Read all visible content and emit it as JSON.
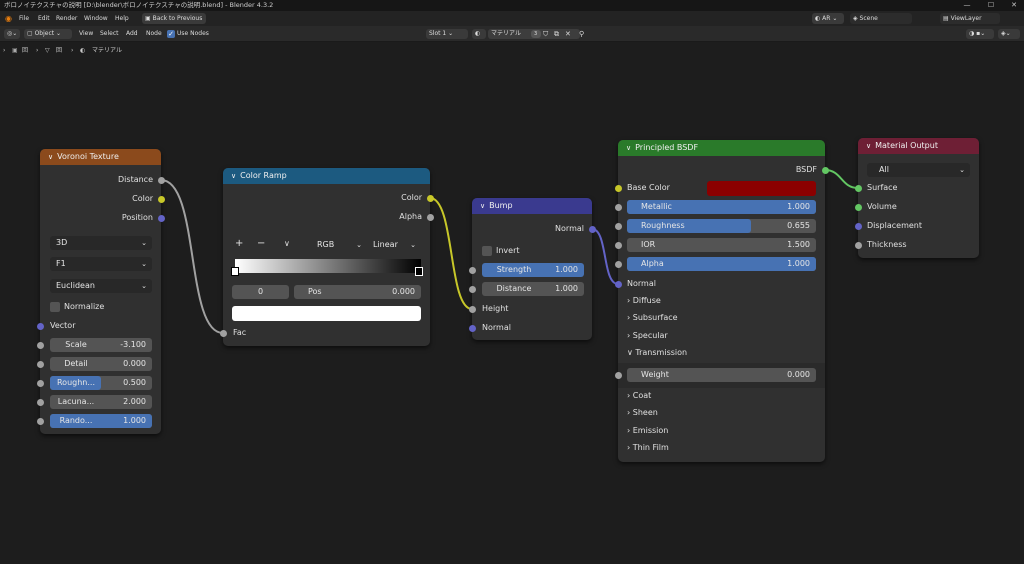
{
  "titlebar": {
    "title": "ボロノイテクスチャの説明 [D:\\blender\\ボロノイテクスチャの説明.blend] - Blender 4.3.2",
    "minimize": "—",
    "maximize": "☐",
    "close": "✕"
  },
  "menubar": {
    "items": [
      "File",
      "Edit",
      "Render",
      "Window",
      "Help"
    ],
    "back_button": "Back to Previous",
    "ar_label": "AR",
    "scene_label": "Scene",
    "viewlayer_label": "ViewLayer"
  },
  "header": {
    "mode": "Object",
    "menus": [
      "View",
      "Select",
      "Add",
      "Node"
    ],
    "use_nodes_label": "Use Nodes",
    "slot": "Slot 1",
    "material_name": "マテリアル",
    "user_count": "3"
  },
  "breadcrumb": {
    "item1": "回",
    "item2": "回",
    "item3": "マテリアル"
  },
  "voronoi": {
    "title": "Voronoi Texture",
    "outputs": [
      "Distance",
      "Color",
      "Position"
    ],
    "dimensions": "3D",
    "feature": "F1",
    "metric": "Euclidean",
    "normalize_label": "Normalize",
    "vector_label": "Vector",
    "fields": [
      {
        "label": "Scale",
        "value": "-3.100",
        "fill": 0
      },
      {
        "label": "Detail",
        "value": "0.000",
        "fill": 0
      },
      {
        "label": "Roughn...",
        "value": "0.500",
        "fill": 0.5
      },
      {
        "label": "Lacuna...",
        "value": "2.000",
        "fill": 0
      },
      {
        "label": "Rando...",
        "value": "1.000",
        "fill": 1
      }
    ]
  },
  "colorramp": {
    "title": "Color Ramp",
    "outputs": [
      "Color",
      "Alpha"
    ],
    "add": "+",
    "remove": "−",
    "menu": "∨",
    "color_mode": "RGB",
    "interpolation": "Linear",
    "stop_index": "0",
    "pos_label": "Pos",
    "pos_value": "0.000",
    "fac_label": "Fac"
  },
  "bump": {
    "title": "Bump",
    "output": "Normal",
    "invert_label": "Invert",
    "strength_label": "Strength",
    "strength_value": "1.000",
    "distance_label": "Distance",
    "distance_value": "1.000",
    "height_label": "Height",
    "normal_label": "Normal"
  },
  "bsdf": {
    "title": "Principled BSDF",
    "output": "BSDF",
    "base_color_label": "Base Color",
    "base_color_swatch": "#8b0000",
    "fields": [
      {
        "label": "Metallic",
        "value": "1.000",
        "fill": 1
      },
      {
        "label": "Roughness",
        "value": "0.655",
        "fill": 0.655
      },
      {
        "label": "IOR",
        "value": "1.500",
        "fill": 0
      },
      {
        "label": "Alpha",
        "value": "1.000",
        "fill": 1
      }
    ],
    "normal_label": "Normal",
    "panels1": [
      "Diffuse",
      "Subsurface",
      "Specular"
    ],
    "transmission_label": "Transmission",
    "weight_label": "Weight",
    "weight_value": "0.000",
    "panels2": [
      "Coat",
      "Sheen",
      "Emission",
      "Thin Film"
    ]
  },
  "output": {
    "title": "Material Output",
    "target": "All",
    "inputs": [
      "Surface",
      "Volume",
      "Displacement",
      "Thickness"
    ]
  },
  "colors": {
    "voronoi_header": "#8b4a1c",
    "colorramp_header": "#1c5a80",
    "bump_header": "#3a3a8f",
    "bsdf_header": "#2a7a2a",
    "output_header": "#6e1f35",
    "accent": "#4772b3"
  }
}
